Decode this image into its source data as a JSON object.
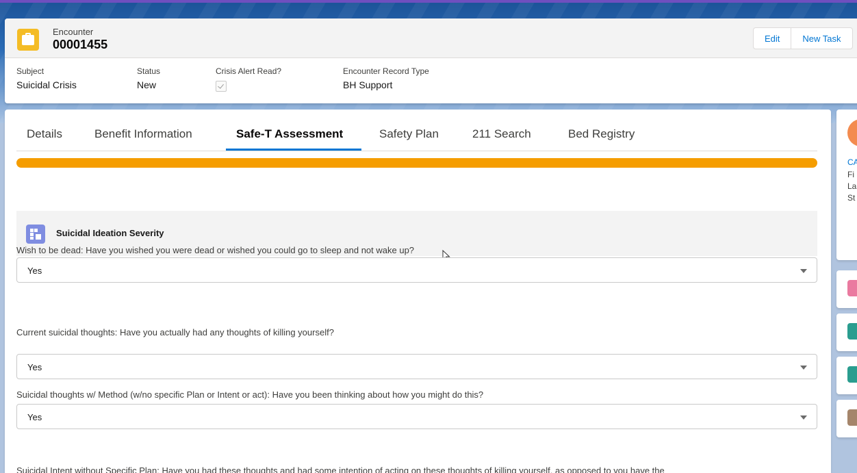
{
  "colors": {
    "accent": "#0176d3",
    "progress": "#f59d00",
    "record_icon": "#f4bc25",
    "section_icon": "#7f8de1"
  },
  "header": {
    "object_label": "Encounter",
    "record_name": "00001455",
    "record_icon": "briefcase-icon",
    "buttons": {
      "edit": "Edit",
      "new_task": "New Task"
    },
    "fields": [
      {
        "label": "Subject",
        "value": "Suicidal Crisis"
      },
      {
        "label": "Status",
        "value": "New"
      },
      {
        "label": "Crisis Alert Read?",
        "checked": true
      },
      {
        "label": "Encounter Record Type",
        "value": "BH Support"
      }
    ]
  },
  "tabs": [
    {
      "label": "Details"
    },
    {
      "label": "Benefit Information"
    },
    {
      "label": "Safe-T Assessment",
      "active": true
    },
    {
      "label": "Safety Plan"
    },
    {
      "label": "211 Search"
    },
    {
      "label": "Bed Registry"
    }
  ],
  "progress_percent": 100,
  "section": {
    "icon": "table-icon",
    "title": "Suicidal Ideation Severity"
  },
  "questions": [
    {
      "label": "Wish to be dead: Have you wished you were dead or wished you could go to sleep and not wake up?",
      "value": "Yes"
    },
    {
      "label": "Current suicidal thoughts: Have you actually had any thoughts of killing yourself?",
      "value": "Yes"
    },
    {
      "label": "Suicidal thoughts w/ Method (w/no specific Plan or Intent or act): Have you been thinking about how you might do this?",
      "value": "Yes"
    },
    {
      "label": "Suicidal Intent without Specific Plan: Have you had these thoughts and had some intention of acting on these thoughts of killing yourself, as opposed to you have the"
    }
  ],
  "sidebar": {
    "avatar_icon": "contact-icon",
    "link": "CA",
    "lines": [
      "Fi",
      "La",
      "St"
    ],
    "tile_icons": [
      "calendar-icon",
      "wrench-icon",
      "wrench-icon",
      "clipboard-icon"
    ],
    "tile_colors": [
      "#ea7aa0",
      "#2a9d8f",
      "#2a9d8f",
      "#a5856b"
    ]
  }
}
